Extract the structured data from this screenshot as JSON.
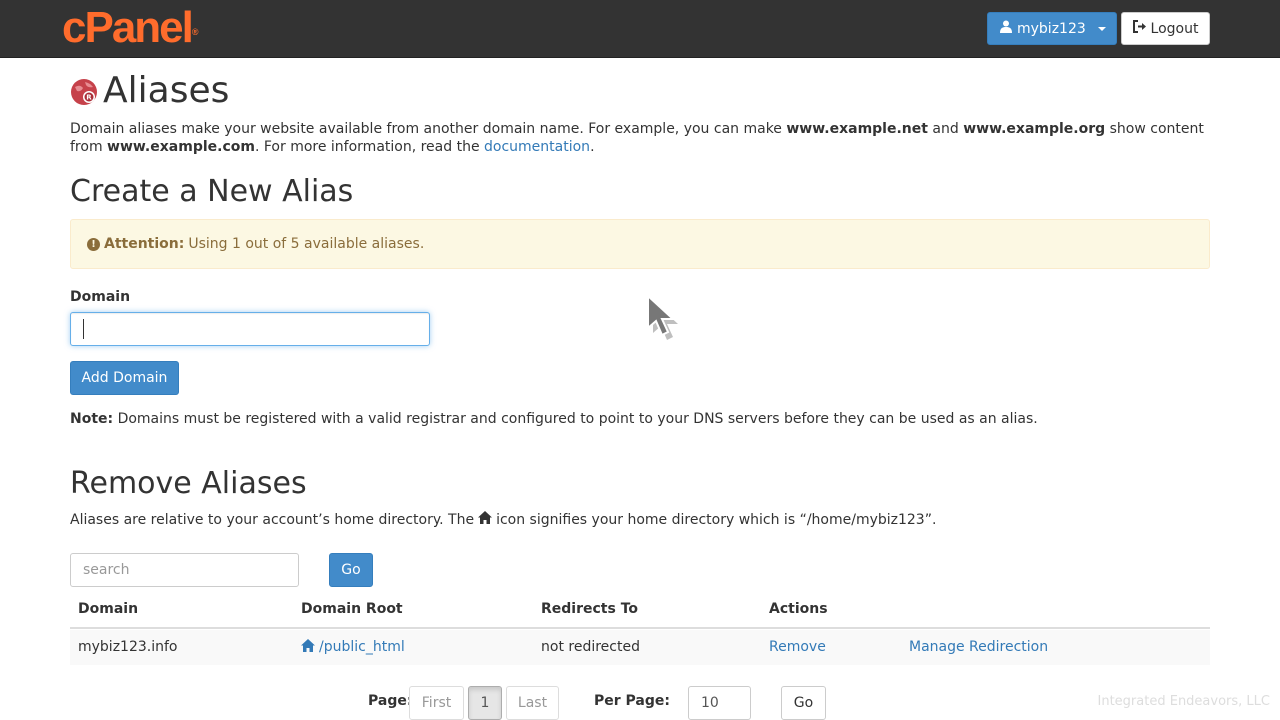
{
  "header": {
    "logo": "cPanel",
    "logo_mark": "®",
    "user_label": "mybiz123",
    "logout_label": "Logout"
  },
  "page": {
    "title": "Aliases",
    "intro_1": "Domain aliases make your website available from another domain name. For example, you can make ",
    "intro_ex1": "www.example.net",
    "intro_2": " and ",
    "intro_ex2": "www.example.org",
    "intro_3": " show content from ",
    "intro_ex3": "www.example.com",
    "intro_4": ". For more information, read the ",
    "intro_link": "documentation",
    "intro_5": "."
  },
  "create": {
    "heading": "Create a New Alias",
    "alert_bold": "Attention:",
    "alert_text": "Using 1 out of 5 available aliases.",
    "domain_label": "Domain",
    "domain_value": "",
    "add_button": "Add Domain",
    "note_bold": "Note:",
    "note_text": " Domains must be registered with a valid registrar and configured to point to your DNS servers before they can be used as an alias."
  },
  "remove": {
    "heading": "Remove Aliases",
    "desc_1": "Aliases are relative to your account’s home directory. The",
    "desc_2": "icon signifies your home directory which is “/home/mybiz123”.",
    "search_placeholder": "search",
    "go_label": "Go",
    "columns": [
      "Domain",
      "Domain Root",
      "Redirects To",
      "Actions"
    ],
    "rows": [
      {
        "domain": "mybiz123.info",
        "root": "/public_html",
        "redirect": "not redirected",
        "action_remove": "Remove",
        "action_manage": "Manage Redirection"
      }
    ]
  },
  "pager": {
    "page_label": "Page:",
    "first": "First",
    "current": "1",
    "last": "Last",
    "per_page_label": "Per Page:",
    "per_page_value": "10",
    "go_label": "Go"
  },
  "footer": {
    "brand": "Integrated Endeavors, LLC"
  },
  "colors": {
    "topbar": "#333333",
    "logo": "#ff6c2c",
    "primary": "#428bca",
    "link": "#337ab7",
    "alert_bg": "#fcf8e3",
    "alert_text": "#8a6d3b"
  }
}
